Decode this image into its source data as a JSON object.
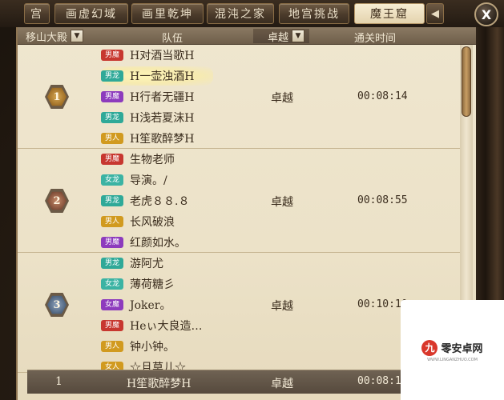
{
  "tabs": [
    {
      "label": "宫",
      "active": false
    },
    {
      "label": "画虚幻域",
      "active": false
    },
    {
      "label": "画里乾坤",
      "active": false
    },
    {
      "label": "混沌之家",
      "active": false
    },
    {
      "label": "地宫挑战",
      "active": false
    },
    {
      "label": "魔王窟",
      "active": true
    }
  ],
  "tab_arrow": "◀",
  "close_label": "X",
  "header": {
    "map_select": "移山大殿",
    "team": "队伍",
    "result_select": "卓越",
    "time": "通关时间"
  },
  "groups": [
    {
      "rank": "1",
      "result": "卓越",
      "time": "00:08:14",
      "members": [
        {
          "tag": "男魔",
          "name": "H对酒当歌H",
          "tag_color": "#c7372f"
        },
        {
          "tag": "男龙",
          "name": "H一壶浊酒H",
          "tag_color": "#2fa998",
          "highlighted": true
        },
        {
          "tag": "男魔",
          "name": "H行者无疆H",
          "tag_color": "#8d3bbd"
        },
        {
          "tag": "男龙",
          "name": "H浅若夏沫H",
          "tag_color": "#2fa998"
        },
        {
          "tag": "男人",
          "name": "H笙歌醉梦H",
          "tag_color": "#d19a1f"
        }
      ]
    },
    {
      "rank": "2",
      "result": "卓越",
      "time": "00:08:55",
      "members": [
        {
          "tag": "男魔",
          "name": "生物老师",
          "tag_color": "#c7372f"
        },
        {
          "tag": "女龙",
          "name": "导演。/",
          "tag_color": "#3bb3a3"
        },
        {
          "tag": "男龙",
          "name": "老虎８８.８",
          "tag_color": "#2fa998"
        },
        {
          "tag": "男人",
          "name": "长风破浪",
          "tag_color": "#d19a1f"
        },
        {
          "tag": "男魔",
          "name": "红颜如水。",
          "tag_color": "#8d3bbd"
        }
      ]
    },
    {
      "rank": "3",
      "result": "卓越",
      "time": "00:10:10",
      "members": [
        {
          "tag": "男龙",
          "name": "游阿尤",
          "tag_color": "#2fa998"
        },
        {
          "tag": "女龙",
          "name": "薄荷糖彡",
          "tag_color": "#3bb3a3"
        },
        {
          "tag": "女魔",
          "name": "Joker。",
          "tag_color": "#8d3bbd"
        },
        {
          "tag": "男魔",
          "name": "Heぃ大良造…",
          "tag_color": "#c7372f"
        },
        {
          "tag": "男人",
          "name": "钟小钟。",
          "tag_color": "#d19a1f"
        },
        {
          "tag": "女人",
          "name": "☆且莫儿☆",
          "tag_color": "#d19a1f"
        }
      ]
    }
  ],
  "self_row": {
    "rank": "1",
    "name": "H笙歌醉梦H",
    "result": "卓越",
    "time": "00:08:14"
  },
  "watermark": {
    "mark": "九",
    "name": "零安卓网",
    "sub": "WWW.LINGANZHUO.COM"
  }
}
